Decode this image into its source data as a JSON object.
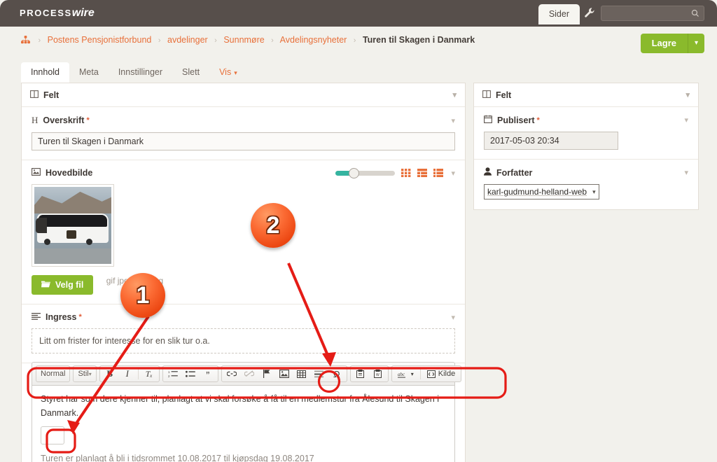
{
  "masthead": {
    "logo_a": "PROCESS",
    "logo_b": "wire",
    "tab_label": "Sider",
    "wrench_icon": "wrench-icon",
    "search_placeholder": "",
    "search_value": "",
    "search_icon": "search-icon"
  },
  "breadcrumb": {
    "home_icon": "sitemap-icon",
    "items": [
      {
        "label": "Postens Pensjonistforbund",
        "current": false
      },
      {
        "label": "avdelinger",
        "current": false
      },
      {
        "label": "Sunnmøre",
        "current": false
      },
      {
        "label": "Avdelingsnyheter",
        "current": false
      },
      {
        "label": "Turen til Skagen i Danmark",
        "current": true
      }
    ],
    "separator": "›"
  },
  "actions": {
    "save_label": "Lagre",
    "save_caret_icon": "chevron-down-icon",
    "save_color": "#8aba2c"
  },
  "tabs": [
    {
      "label": "Innhold",
      "active": true,
      "accent": false
    },
    {
      "label": "Meta",
      "active": false,
      "accent": false
    },
    {
      "label": "Innstillinger",
      "active": false,
      "accent": false
    },
    {
      "label": "Slett",
      "active": false,
      "accent": false
    },
    {
      "label": "Vis",
      "active": false,
      "accent": true,
      "caret": "⌄"
    }
  ],
  "left_panel": {
    "header": {
      "icon": "columns-icon",
      "title": "Felt",
      "caret": "chevron-down-icon"
    },
    "overskrift": {
      "icon": "H",
      "label": "Overskrift",
      "required": "*",
      "value": "Turen til Skagen i Danmark",
      "caret": "chevron-down-icon"
    },
    "hovedbilde": {
      "icon": "image-icon",
      "label": "Hovedbilde",
      "caret": "chevron-down-icon",
      "slider_percent": 26,
      "view_icons": [
        "grid-view-icon",
        "list-left-view-icon",
        "list-view-icon"
      ],
      "select_file_label": "Velg fil",
      "select_file_icon": "folder-open-icon",
      "file_hint": "gif jpg jpeg png",
      "thumbnail_alt": "bus-photo"
    },
    "ingress": {
      "icon": "align-left-icon",
      "label": "Ingress",
      "required": "*",
      "caret": "chevron-down-icon",
      "value": "Litt om frister for interesse for en slik tur o.a."
    }
  },
  "editor": {
    "combo_format": "Normal",
    "combo_style": "Stil",
    "combo_caret": "·",
    "buttons": [
      {
        "name": "bold-icon",
        "glyph": "B",
        "disabled": false
      },
      {
        "name": "italic-icon",
        "glyph": "I",
        "disabled": false
      },
      {
        "name": "remove-format-icon",
        "glyph": "Tₓ",
        "disabled": false
      },
      {
        "name": "numbered-list-icon",
        "glyph": "≡",
        "disabled": false
      },
      {
        "name": "bulleted-list-icon",
        "glyph": "⁝",
        "disabled": false
      },
      {
        "name": "blockquote-icon",
        "glyph": "”",
        "disabled": false
      },
      {
        "name": "link-icon",
        "glyph": "⚭",
        "disabled": false
      },
      {
        "name": "unlink-icon",
        "glyph": "⚭",
        "disabled": true
      },
      {
        "name": "anchor-icon",
        "glyph": "⚑",
        "disabled": false
      },
      {
        "name": "image-icon",
        "glyph": "⛰",
        "disabled": false,
        "highlighted": true
      },
      {
        "name": "table-icon",
        "glyph": "☷",
        "disabled": false
      },
      {
        "name": "horizontal-rule-icon",
        "glyph": "☰",
        "disabled": false
      },
      {
        "name": "special-char-icon",
        "glyph": "Ω",
        "disabled": false
      },
      {
        "name": "paste-text-icon",
        "glyph": "⎘",
        "disabled": false
      },
      {
        "name": "paste-word-icon",
        "glyph": "⎙",
        "disabled": false
      },
      {
        "name": "spellcheck-icon",
        "glyph": "✓",
        "disabled": false
      }
    ],
    "source_label": "Kilde",
    "source_icon": "source-icon",
    "body_paragraph": "Styret har som dere kjenner til, planlagt at vi skal forsøke å få til en medlemstur fra Ålesund til Skagen i Danmark.",
    "body_trailing": "Turen er planlagt å bli i tidsrommet 10.08.2017 til kjøpsdag 19.08.2017"
  },
  "right_panel": {
    "header": {
      "icon": "columns-icon",
      "title": "Felt",
      "caret": "chevron-down-icon"
    },
    "publisert": {
      "icon": "calendar-icon",
      "label": "Publisert",
      "required": "*",
      "caret": "chevron-down-icon",
      "value": "2017-05-03 20:34"
    },
    "forfatter": {
      "icon": "user-icon",
      "label": "Forfatter",
      "caret": "chevron-down-icon",
      "value": "karl-gudmund-helland-web",
      "select_caret": "chevron-down-icon"
    }
  },
  "annotations": {
    "badge_1": "1",
    "badge_2": "2",
    "highlight_color": "#e51c16",
    "badge_color": "#ec4712"
  }
}
